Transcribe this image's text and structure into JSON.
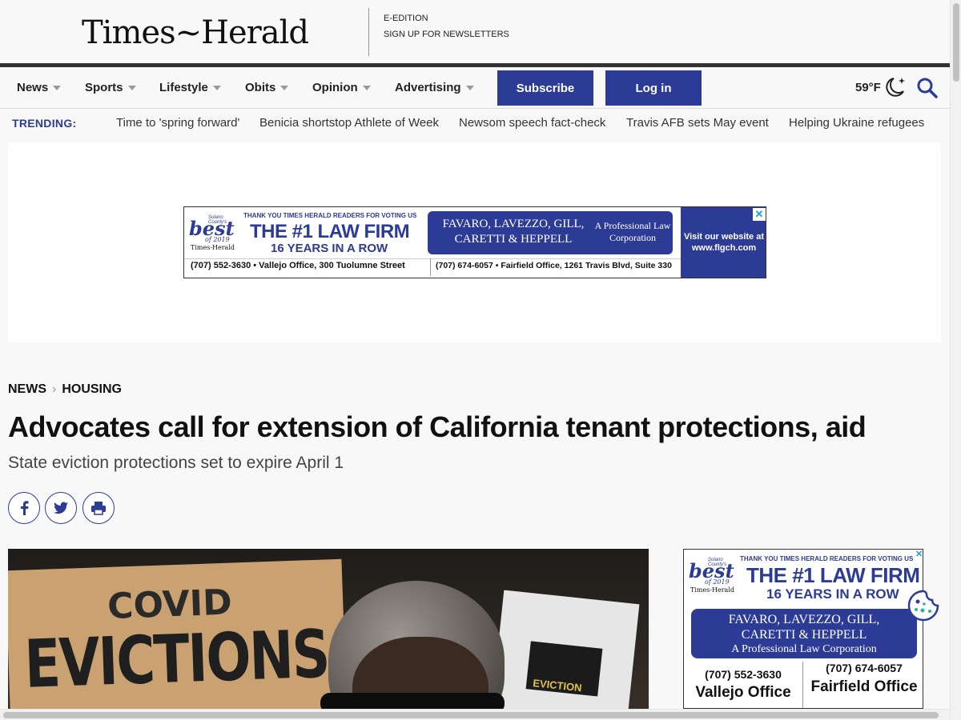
{
  "brand": {
    "logo": "Times~Herald"
  },
  "utility_links": [
    "E-EDITION",
    "SIGN UP FOR NEWSLETTERS"
  ],
  "nav": {
    "items": [
      "News",
      "Sports",
      "Lifestyle",
      "Obits",
      "Opinion",
      "Advertising"
    ],
    "subscribe_label": "Subscribe",
    "login_label": "Log in",
    "weather": "59°F"
  },
  "trending": {
    "label": "TRENDING:",
    "items": [
      "Time to 'spring forward'",
      "Benicia shortstop Athlete of Week",
      "Newsom speech fact-check",
      "Travis AFB sets May event",
      "Helping Ukraine refugees"
    ]
  },
  "banner_ad": {
    "best_badge": "best",
    "best_small": "Solano County's",
    "best_year": "of 2019",
    "best_source": "Times-Herald",
    "thank_you": "THANK YOU TIMES HERALD READERS FOR VOTING US",
    "headline": "THE #1 LAW FIRM",
    "subline": "16 YEARS IN A ROW",
    "firm_names": "FAVARO, LAVEZZO, GILL, CARETTI & HEPPELL",
    "firm_type": "A Professional Law Corporation",
    "cta": "Visit our website at www.flgch.com",
    "vallejo": "(707) 552-3630 • Vallejo Office, 300 Tuolumne Street",
    "fairfield": "(707) 674-6057 • Fairfield Office, 1261 Travis Blvd, Suite 330"
  },
  "article": {
    "breadcrumb": [
      "NEWS",
      "HOUSING"
    ],
    "headline": "Advocates call for extension of California tenant protections, aid",
    "subhead": "State eviction protections set to expire April 1"
  },
  "photo": {
    "sign_line1": "COVID",
    "sign_line2": "EVICTIONS",
    "sign_small": "EVICTION"
  },
  "side_ad": {
    "thank_you": "THANK YOU TIMES HERALD READERS FOR VOTING US",
    "headline": "THE #1 LAW FIRM",
    "subline": "16 YEARS IN A ROW",
    "firm_line1": "FAVARO, LAVEZZO, GILL,",
    "firm_line2": "CARETTI & HEPPELL",
    "firm_line3": "A Professional Law Corporation",
    "phone1": "(707) 552-3630",
    "office1": "Vallejo Office",
    "phone2": "(707) 674-6057",
    "office2": "Fairfield Office"
  },
  "colors": {
    "accent": "#2c3b96",
    "nav_border": "#333333"
  },
  "icons": [
    "caret-down-icon",
    "moon-icon",
    "search-icon",
    "facebook-icon",
    "twitter-icon",
    "print-icon",
    "ad-close-icon",
    "cookie-icon"
  ]
}
